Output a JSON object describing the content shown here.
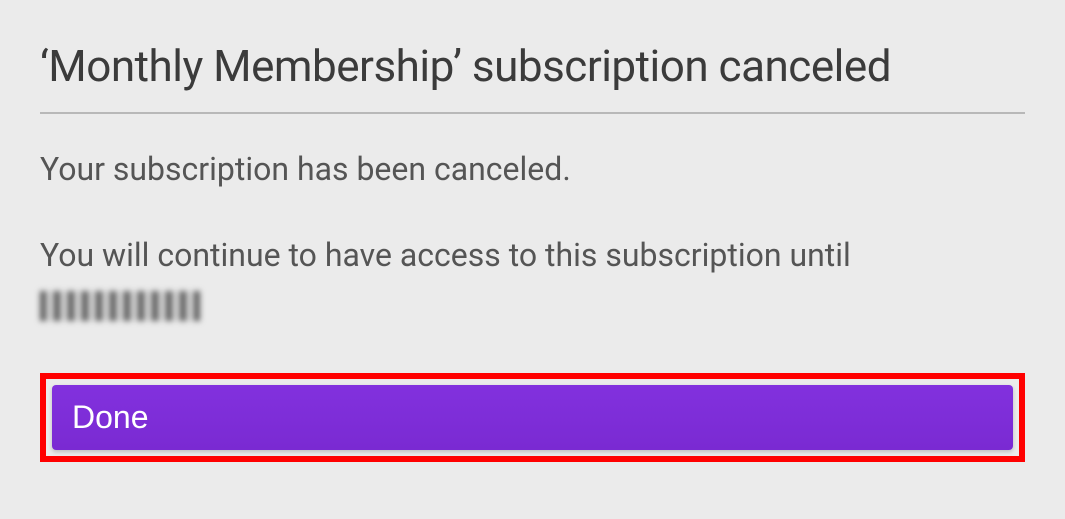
{
  "dialog": {
    "title": "‘Monthly Membership’ subscription canceled",
    "message_line1": "Your subscription has been canceled.",
    "message_line2": "You will continue to have access to this subscription until",
    "expiry_date_redacted": true,
    "done_label": "Done"
  },
  "colors": {
    "background": "#ebebeb",
    "text_primary": "#3b3b3b",
    "text_secondary": "#555555",
    "divider": "#b8b8b8",
    "button_bg": "#7e2fd6",
    "button_text": "#ffffff",
    "highlight_border": "#ff0000"
  }
}
